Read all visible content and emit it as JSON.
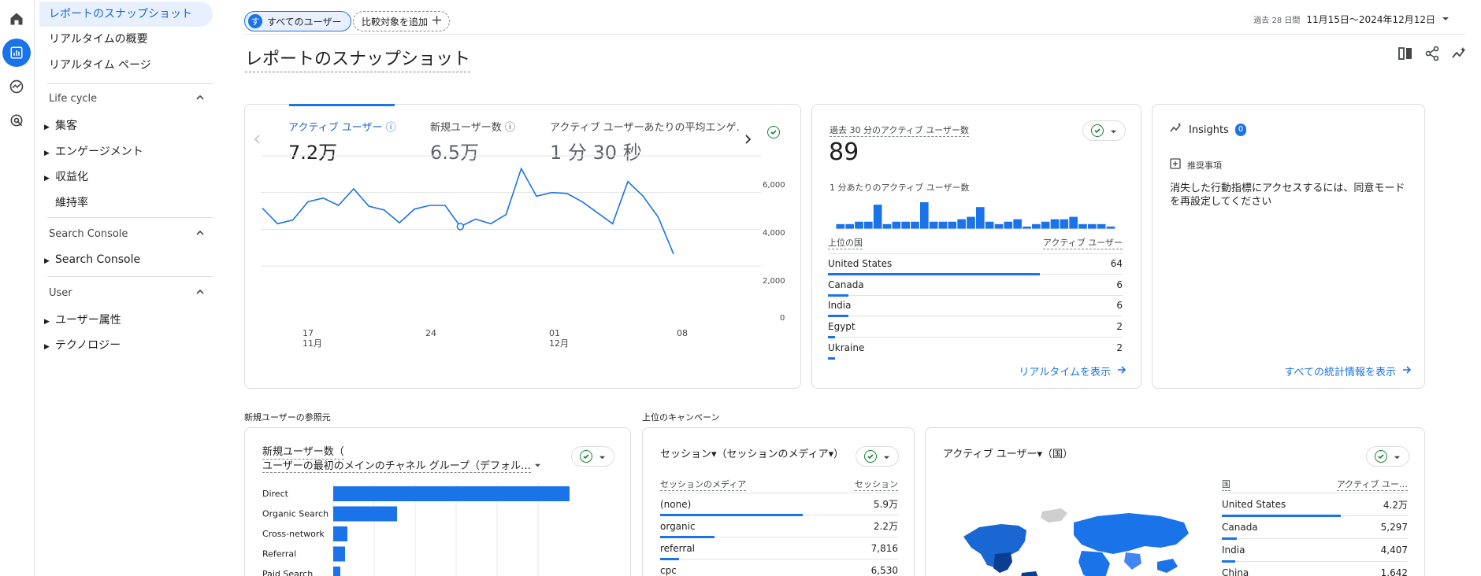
{
  "nav": {
    "top_items": [
      "レポートのスナップショット",
      "リアルタイムの概要",
      "リアルタイム ページ"
    ],
    "sections": [
      {
        "title": "Life cycle",
        "items": [
          {
            "label": "集客",
            "expandable": true
          },
          {
            "label": "エンゲージメント",
            "expandable": true
          },
          {
            "label": "収益化",
            "expandable": true
          },
          {
            "label": "維持率",
            "expandable": false
          }
        ]
      },
      {
        "title": "Search Console",
        "items": [
          {
            "label": "Search Console",
            "expandable": true
          }
        ]
      },
      {
        "title": "User",
        "items": [
          {
            "label": "ユーザー属性",
            "expandable": true
          },
          {
            "label": "テクノロジー",
            "expandable": true
          }
        ]
      }
    ]
  },
  "header": {
    "all_users_avatar": "す",
    "all_users": "すべてのユーザー",
    "add_comparison": "比較対象を追加",
    "range_prefix": "過去 28 日間",
    "range": "11月15日～2024年12月12日",
    "page_title": "レポートのスナップショット"
  },
  "overview": {
    "kpis": [
      {
        "label": "アクティブ ユーザー",
        "value": "7.2万",
        "selected": true
      },
      {
        "label": "新規ユーザー数",
        "value": "6.5万",
        "selected": false
      },
      {
        "label": "アクティブ ユーザーあたりの平均エンゲ…",
        "value": "1 分 30 秒",
        "selected": false
      }
    ],
    "y_ticks": [
      "6,000",
      "4,000",
      "2,000",
      "0"
    ],
    "x_ticks": [
      {
        "day": "17",
        "month": "11月"
      },
      {
        "day": "24",
        "month": ""
      },
      {
        "day": "01",
        "month": "12月"
      },
      {
        "day": "08",
        "month": ""
      }
    ]
  },
  "chart_data": {
    "type": "line",
    "ylim": [
      0,
      6000
    ],
    "x": [
      "11月15日",
      "11月16日",
      "11月17日",
      "11月18日",
      "11月19日",
      "11月20日",
      "11月21日",
      "11月22日",
      "11月23日",
      "11月24日",
      "11月25日",
      "11月26日",
      "11月27日",
      "11月28日",
      "11月29日",
      "11月30日",
      "12月1日",
      "12月2日",
      "12月3日",
      "12月4日",
      "12月5日",
      "12月6日",
      "12月7日",
      "12月8日",
      "12月9日",
      "12月10日",
      "12月11日",
      "12月12日"
    ],
    "values": [
      3150,
      2300,
      2500,
      3500,
      3700,
      3300,
      4200,
      3250,
      3050,
      2350,
      3100,
      3300,
      3300,
      2150,
      2550,
      2300,
      2800,
      5300,
      3800,
      4000,
      3950,
      3500,
      2900,
      2300,
      4600,
      3800,
      2650,
      650
    ]
  },
  "realtime": {
    "title": "過去 30 分のアクティブ ユーザー数",
    "value": "89",
    "per_minute_label": "1 分あたりのアクティブ ユーザー数",
    "per_minute_values": [
      2,
      2,
      3,
      3,
      10,
      2,
      3,
      3,
      3,
      11,
      3,
      3,
      3,
      4,
      5,
      9,
      3,
      2,
      3,
      4,
      1,
      2,
      3,
      4,
      4,
      5,
      2,
      2,
      2,
      1
    ],
    "col_country": "上位の国",
    "col_users": "アクティブ ユーザー",
    "rows": [
      {
        "country": "United States",
        "users": "64",
        "fraction": 0.72
      },
      {
        "country": "Canada",
        "users": "6",
        "fraction": 0.07
      },
      {
        "country": "India",
        "users": "6",
        "fraction": 0.07
      },
      {
        "country": "Egypt",
        "users": "2",
        "fraction": 0.025
      },
      {
        "country": "Ukraine",
        "users": "2",
        "fraction": 0.025
      }
    ],
    "link": "リアルタイムを表示"
  },
  "insights": {
    "title": "Insights",
    "badge": "0",
    "recommend": "推奨事項",
    "message": "消失した行動指標にアクセスするには、同意モードを再設定してください",
    "link": "すべての統計情報を表示"
  },
  "sources": {
    "section_label": "新規ユーザーの参照元",
    "title_line1": "新規ユーザー数（",
    "title_line2": "ユーザーの最初のメインのチャネル グループ（デフォル…",
    "rows": [
      {
        "label": "Direct",
        "fraction": 1.0
      },
      {
        "label": "Organic Search",
        "fraction": 0.27
      },
      {
        "label": "Cross-network",
        "fraction": 0.06
      },
      {
        "label": "Referral",
        "fraction": 0.05
      },
      {
        "label": "Paid Search",
        "fraction": 0.03
      }
    ]
  },
  "campaigns": {
    "section_label": "上位のキャンペーン",
    "title": "セッション▾（セッションのメディア▾）",
    "col_media": "セッションのメディア",
    "col_sessions": "セッション",
    "rows": [
      {
        "media": "(none)",
        "sessions": "5.9万",
        "fraction": 0.6
      },
      {
        "media": "organic",
        "sessions": "2.2万",
        "fraction": 0.23
      },
      {
        "media": "referral",
        "sessions": "7,816",
        "fraction": 0.08
      },
      {
        "media": "cpc",
        "sessions": "6,530",
        "fraction": 0.07
      }
    ]
  },
  "countries": {
    "title": "アクティブ ユーザー▾（国）",
    "col_country": "国",
    "col_users": "アクティブ ユー…",
    "rows": [
      {
        "country": "United States",
        "users": "4.2万",
        "fraction": 0.64
      },
      {
        "country": "Canada",
        "users": "5,297",
        "fraction": 0.08
      },
      {
        "country": "India",
        "users": "4,407",
        "fraction": 0.07
      },
      {
        "country": "China",
        "users": "1,642",
        "fraction": 0.03
      }
    ]
  }
}
